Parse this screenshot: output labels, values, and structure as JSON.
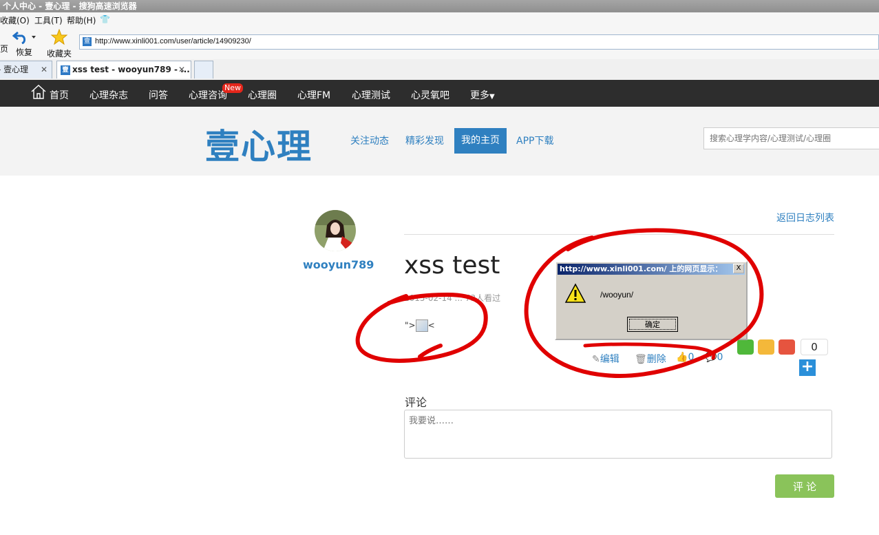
{
  "browser": {
    "window_title": "个人中心 - 壹心理 - 搜狗高速浏览器",
    "menu": [
      "收藏(O)",
      "工具(T)",
      "帮助(H)"
    ],
    "toolbar": {
      "page_label": "页",
      "restore_label": "恢复",
      "favorites_label": "收藏夹"
    },
    "address": "http://www.xinli001.com/user/article/14909230/",
    "tabs": [
      {
        "title": "- 壹心理"
      },
      {
        "title": "xss test - wooyun789 - ..."
      }
    ]
  },
  "site_nav": {
    "items": [
      "首页",
      "心理杂志",
      "问答",
      "心理咨询",
      "心理圈",
      "心理FM",
      "心理测试",
      "心灵氧吧",
      "更多"
    ],
    "new_badge": "New"
  },
  "header": {
    "logo": "壹心理",
    "links": [
      "关注动态",
      "精彩发现",
      "我的主页",
      "APP下载"
    ],
    "active_link": "我的主页",
    "search_placeholder": "搜索心理学内容/心理测试/心理圈"
  },
  "profile": {
    "username": "wooyun789"
  },
  "article": {
    "back_link": "返回日志列表",
    "title": "xss test",
    "meta": "2015-02-14 ... 73人看过",
    "body": "\">",
    "body_tail": "<",
    "actions": {
      "edit": "编辑",
      "delete": "删除",
      "likes": "0",
      "comments": "0"
    },
    "share_count": "0"
  },
  "comment": {
    "label": "评论",
    "placeholder": "我要说……",
    "button": "评 论"
  },
  "dialog": {
    "title": "http://www.xinli001.com/ 上的网页显示：",
    "message": "/wooyun/",
    "ok": "确定",
    "close": "X"
  },
  "colors": {
    "brand": "#2f80c0",
    "nav_bg": "#2d2d2d",
    "annotation": "#e00000",
    "comment_button": "#8ac35a"
  }
}
